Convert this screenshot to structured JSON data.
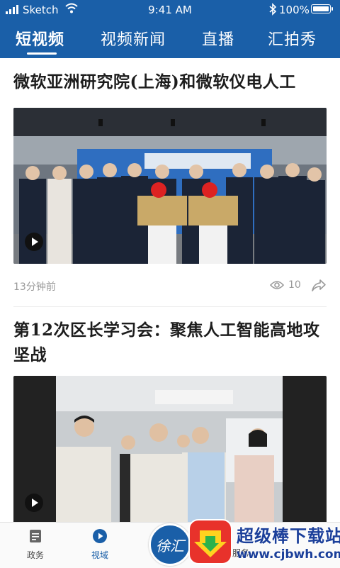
{
  "status_bar": {
    "carrier": "Sketch",
    "time": "9:41 AM",
    "battery": "100%"
  },
  "top_nav": {
    "tabs": [
      {
        "label": "短视频"
      },
      {
        "label": "视频新闻"
      },
      {
        "label": "直播"
      },
      {
        "label": "汇拍秀"
      }
    ],
    "active_index": 0
  },
  "articles": [
    {
      "title": "微软亚洲研究院(上海)和微软仪电人工",
      "time_ago": "13分钟前",
      "views": "10"
    },
    {
      "title": "第12次区长学习会：聚焦人工智能高地攻坚战"
    }
  ],
  "bottom_nav": {
    "items": [
      {
        "label": "政务"
      },
      {
        "label": "视域"
      },
      {
        "label": "服务"
      }
    ],
    "center_logo": "徐汇"
  },
  "watermark": {
    "title": "超级棒下载站",
    "url": "www.cjbwh.com"
  },
  "colors": {
    "brand_blue": "#1a5fa8",
    "meta_gray": "#999999"
  }
}
